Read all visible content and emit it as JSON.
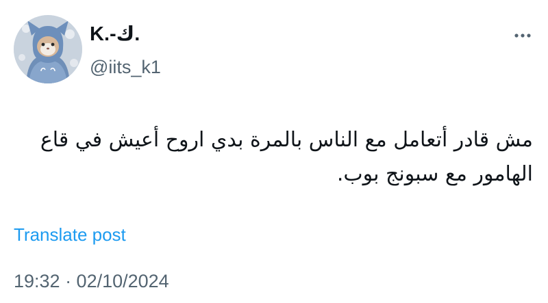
{
  "author": {
    "display_name": "K.-ك.",
    "handle": "@iits_k1"
  },
  "post": {
    "text": "مش قادر أتعامل مع الناس بالمرة بدي اروح أعيش في قاع الهامور مع سبونج بوب.",
    "translate_label": "Translate post",
    "timestamp": "19:32 · 02/10/2024"
  },
  "icons": {
    "more": "more-horizontal-icon",
    "avatar": "cat-in-blue-hood-avatar"
  },
  "colors": {
    "text_primary": "#0f1419",
    "text_secondary": "#536471",
    "link": "#1d9bf0",
    "background": "#ffffff"
  }
}
